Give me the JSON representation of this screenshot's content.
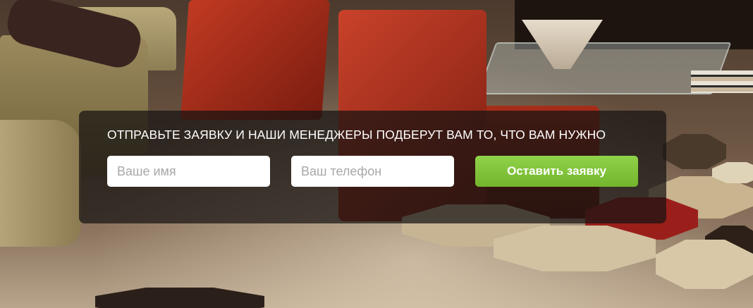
{
  "lead_form": {
    "headline": "ОТПРАВЬТЕ ЗАЯВКУ И НАШИ МЕНЕДЖЕРЫ ПОДБЕРУТ ВАМ ТО, ЧТО ВАМ НУЖНО",
    "name_placeholder": "Ваше имя",
    "phone_placeholder": "Ваш телефон",
    "submit_label": "Оставить заявку"
  },
  "colors": {
    "submit_button": "#7fc43a",
    "panel_overlay": "#161412",
    "input_background": "#ffffff"
  }
}
